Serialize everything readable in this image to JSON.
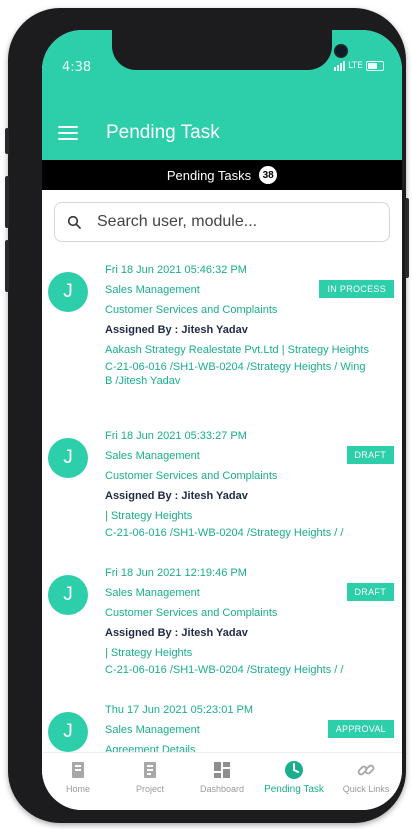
{
  "status_bar": {
    "time": "4:38",
    "network": "LTE"
  },
  "header": {
    "title": "Pending Task"
  },
  "subheader": {
    "label": "Pending Tasks",
    "count": "38"
  },
  "search": {
    "placeholder": "Search user, module..."
  },
  "tasks": [
    {
      "avatar": "J",
      "datetime": "Fri 18 Jun 2021 05:46:32 PM",
      "module": "Sales Management",
      "category": "Customer Services and Complaints",
      "assigned_by": "Assigned By : Jitesh Yadav",
      "detail1": "Aakash Strategy Realestate Pvt.Ltd | Strategy Heights",
      "detail2": "C-21-06-016 /SH1-WB-0204 /Strategy Heights / Wing B /Jitesh Yadav",
      "status": "IN PROCESS"
    },
    {
      "avatar": "J",
      "datetime": "Fri 18 Jun 2021 05:33:27 PM",
      "module": "Sales Management",
      "category": "Customer Services and Complaints",
      "assigned_by": "Assigned By : Jitesh Yadav",
      "detail1": "| Strategy Heights",
      "detail2": "C-21-06-016 /SH1-WB-0204 /Strategy Heights / /",
      "status": "DRAFT"
    },
    {
      "avatar": "J",
      "datetime": "Fri 18 Jun 2021 12:19:46 PM",
      "module": "Sales Management",
      "category": "Customer Services and Complaints",
      "assigned_by": "Assigned By : Jitesh Yadav",
      "detail1": "| Strategy Heights",
      "detail2": "C-21-06-016 /SH1-WB-0204 /Strategy Heights / /",
      "status": "DRAFT"
    },
    {
      "avatar": "J",
      "datetime": "Thu 17 Jun 2021 05:23:01 PM",
      "module": "Sales Management",
      "category": "Agreement Details",
      "status": "APPROVAL"
    }
  ],
  "tabbar": {
    "home": "Home",
    "project": "Project",
    "dashboard": "Dashboard",
    "pending": "Pending Task",
    "quick_links": "Quick Links"
  },
  "colors": {
    "accent": "#2ccfa9",
    "text_accent": "#1aae8c",
    "dark_text": "#1e2a44"
  }
}
